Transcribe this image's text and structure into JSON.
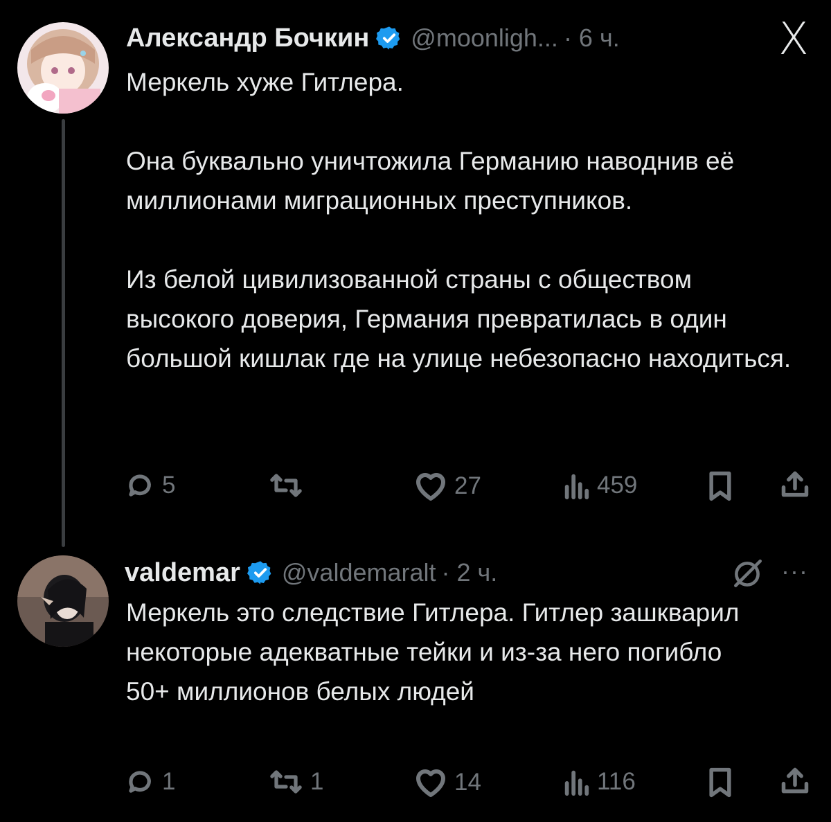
{
  "close_label": "X",
  "tweets": [
    {
      "name": "Александр Бочкин",
      "handle": "@moonligh...",
      "time": "· 6 ч.",
      "paragraphs": [
        "Меркель хуже Гитлера.",
        "Она буквально уничтожила Германию наводнив её миллионами миграционных преступников.",
        "Из белой цивилизованной страны с обществом высокого доверия, Германия превратилась в один большой кишлак где на улице небезопасно находиться."
      ],
      "replies": "5",
      "reposts": "",
      "likes": "27",
      "views": "459"
    },
    {
      "name": "valdemar",
      "handle": "@valdemaralt",
      "time": "· 2 ч.",
      "paragraphs": [
        "Меркель это следствие Гитлера. Гитлер зашкварил некоторые адекватные тейки и из-за него погибло 50+ миллионов белых людей"
      ],
      "replies": "1",
      "reposts": "1",
      "likes": "14",
      "views": "116",
      "more_label": "···"
    }
  ],
  "colors": {
    "accent": "#1d9bf0",
    "text": "#e7e9ea",
    "muted": "#71767b",
    "background": "#000000"
  }
}
